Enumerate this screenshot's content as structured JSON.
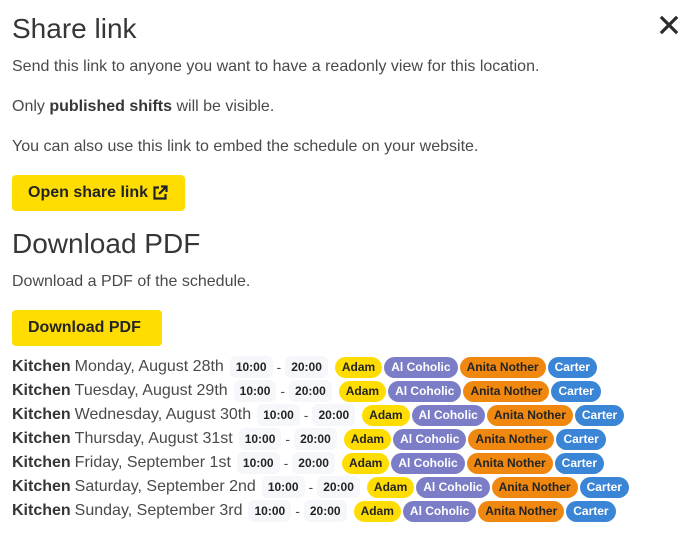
{
  "share": {
    "title": "Share link",
    "desc": "Send this link to anyone you want to have a readonly view for this location.",
    "only_prefix": "Only ",
    "only_bold": "published shifts",
    "only_suffix": " will be visible.",
    "embed": "You can also use this link to embed the schedule on your website.",
    "open_button": "Open share link",
    "open_icon": "external-link-icon",
    "close_icon": "close-icon"
  },
  "pdf": {
    "title": "Download PDF",
    "desc": "Download a PDF of the schedule.",
    "button": "Download PDF"
  },
  "colors": {
    "accent": "#FFDD00",
    "Adam": {
      "bg": "#FFDD00",
      "fg": "#242424"
    },
    "Al Coholic": {
      "bg": "#7B7EC6",
      "fg": "#ffffff"
    },
    "Anita Nother": {
      "bg": "#F0870F",
      "fg": "#242424"
    },
    "Carter": {
      "bg": "#3A85D6",
      "fg": "#ffffff"
    }
  },
  "schedule": [
    {
      "location": "Kitchen",
      "date": "Monday, August 28th",
      "start": "10:00",
      "end": "20:00",
      "people": [
        "Adam",
        "Al Coholic",
        "Anita Nother",
        "Carter"
      ]
    },
    {
      "location": "Kitchen",
      "date": "Tuesday, August 29th",
      "start": "10:00",
      "end": "20:00",
      "people": [
        "Adam",
        "Al Coholic",
        "Anita Nother",
        "Carter"
      ]
    },
    {
      "location": "Kitchen",
      "date": "Wednesday, August 30th",
      "start": "10:00",
      "end": "20:00",
      "people": [
        "Adam",
        "Al Coholic",
        "Anita Nother",
        "Carter"
      ]
    },
    {
      "location": "Kitchen",
      "date": "Thursday, August 31st",
      "start": "10:00",
      "end": "20:00",
      "people": [
        "Adam",
        "Al Coholic",
        "Anita Nother",
        "Carter"
      ]
    },
    {
      "location": "Kitchen",
      "date": "Friday, September 1st",
      "start": "10:00",
      "end": "20:00",
      "people": [
        "Adam",
        "Al Coholic",
        "Anita Nother",
        "Carter"
      ]
    },
    {
      "location": "Kitchen",
      "date": "Saturday, September 2nd",
      "start": "10:00",
      "end": "20:00",
      "people": [
        "Adam",
        "Al Coholic",
        "Anita Nother",
        "Carter"
      ]
    },
    {
      "location": "Kitchen",
      "date": "Sunday, September 3rd",
      "start": "10:00",
      "end": "20:00",
      "people": [
        "Adam",
        "Al Coholic",
        "Anita Nother",
        "Carter"
      ]
    }
  ],
  "separator": "-"
}
